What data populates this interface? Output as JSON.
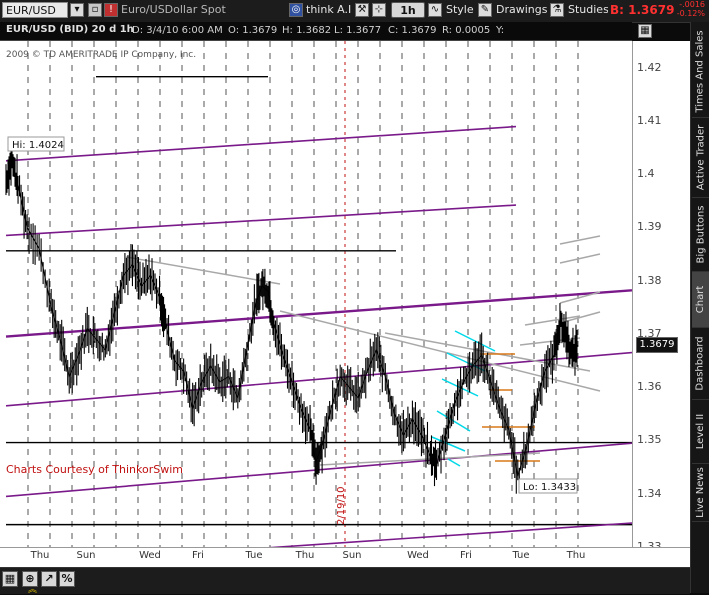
{
  "toolbar": {
    "symbol": "EUR/USD",
    "description": "Euro/USDollar Spot",
    "think_ai_label": "think A.I.",
    "interval": "1h",
    "style_label": "Style",
    "drawings_label": "Drawings",
    "studies_label": "Studies",
    "bid_label": "B:",
    "bid_value": "1.3679",
    "change_value": "-.0016",
    "change_pct": "-0.12%"
  },
  "header": {
    "title": "EUR/USD (BID) 20 d 1h",
    "date": "D: 3/4/10 6:00 AM",
    "open": "O: 1.3679",
    "high": "H: 1.3682",
    "low": "L: 1.3677",
    "close": "C: 1.3679",
    "range": "R: 0.0005",
    "y": "Y:"
  },
  "copyright": "2009 © TD AMERITRADE IP Company, Inc.",
  "watermark": "Charts Courtesy of ThinkorSwim",
  "hi_label": "Hi: 1.4024",
  "lo_label": "Lo: 1.3433",
  "date_marker": "2/19/10",
  "current_price": "1.3679",
  "colors": {
    "channel": "#7a1a8a",
    "support": "#000000",
    "fib": "#00d8e8",
    "orange": "#d8781a",
    "gray": "#a8a8a8",
    "bid": "#ff3030"
  },
  "sidebar": {
    "tabs": [
      "Times And Sales",
      "Active Trader",
      "Big Buttons",
      "Chart",
      "Dashboard",
      "Level II",
      "Live News"
    ]
  },
  "chart_data": {
    "type": "candlestick",
    "title": "EUR/USD (BID) 20 d 1h",
    "ylim": [
      1.33,
      1.425
    ],
    "yticks": [
      1.42,
      1.41,
      1.4,
      1.39,
      1.38,
      1.37,
      1.36,
      1.35,
      1.34,
      1.33
    ],
    "ytick_labels": [
      "1.42",
      "1.41",
      "1.4",
      "1.39",
      "1.38",
      "1.37",
      "1.36",
      "1.35",
      "1.34",
      "1.33"
    ],
    "xtick_labels": [
      "Thu",
      "Sun",
      "Wed",
      "Fri",
      "Tue",
      "Thu",
      "Sun",
      "Wed",
      "Fri",
      "Tue",
      "Thu"
    ],
    "grid": true,
    "price_path": [
      [
        0,
        1.399
      ],
      [
        0.4,
        1.4024
      ],
      [
        0.8,
        1.398
      ],
      [
        1.4,
        1.39
      ],
      [
        2.2,
        1.386
      ],
      [
        3,
        1.375
      ],
      [
        3.6,
        1.369
      ],
      [
        4.2,
        1.362
      ],
      [
        4.8,
        1.366
      ],
      [
        5.4,
        1.371
      ],
      [
        6,
        1.369
      ],
      [
        6.6,
        1.367
      ],
      [
        7.2,
        1.374
      ],
      [
        7.8,
        1.381
      ],
      [
        8.4,
        1.383
      ],
      [
        9,
        1.379
      ],
      [
        9.6,
        1.381
      ],
      [
        10.2,
        1.377
      ],
      [
        10.6,
        1.372
      ],
      [
        11.2,
        1.365
      ],
      [
        11.8,
        1.363
      ],
      [
        12.4,
        1.356
      ],
      [
        13,
        1.361
      ],
      [
        13.6,
        1.364
      ],
      [
        14.2,
        1.361
      ],
      [
        14.8,
        1.362
      ],
      [
        15.4,
        1.358
      ],
      [
        16,
        1.367
      ],
      [
        16.6,
        1.376
      ],
      [
        17,
        1.379
      ],
      [
        17.4,
        1.378
      ],
      [
        17.8,
        1.372
      ],
      [
        18.4,
        1.366
      ],
      [
        19,
        1.361
      ],
      [
        19.6,
        1.356
      ],
      [
        20.2,
        1.352
      ],
      [
        20.6,
        1.346
      ],
      [
        21,
        1.349
      ],
      [
        21.6,
        1.356
      ],
      [
        22.2,
        1.362
      ],
      [
        22.8,
        1.36
      ],
      [
        23.4,
        1.358
      ],
      [
        24,
        1.363
      ],
      [
        24.6,
        1.367
      ],
      [
        25.2,
        1.362
      ],
      [
        25.8,
        1.355
      ],
      [
        26.4,
        1.351
      ],
      [
        27,
        1.354
      ],
      [
        27.6,
        1.351
      ],
      [
        28.2,
        1.347
      ],
      [
        28.6,
        1.3455
      ],
      [
        29.2,
        1.351
      ],
      [
        29.8,
        1.357
      ],
      [
        30.4,
        1.361
      ],
      [
        31,
        1.364
      ],
      [
        31.6,
        1.366
      ],
      [
        32.2,
        1.361
      ],
      [
        32.8,
        1.356
      ],
      [
        33.4,
        1.352
      ],
      [
        34,
        1.3433
      ],
      [
        34.6,
        1.349
      ],
      [
        35.2,
        1.357
      ],
      [
        35.8,
        1.363
      ],
      [
        36.4,
        1.366
      ],
      [
        36.8,
        1.372
      ],
      [
        37.2,
        1.37
      ],
      [
        37.6,
        1.366
      ],
      [
        38,
        1.3679
      ]
    ],
    "channel_lines": [
      {
        "name": "upper",
        "y_start": 1.4025,
        "y_end": 1.4104
      },
      {
        "name": "upper-mid",
        "y_start": 1.3885,
        "y_end": 1.3955
      },
      {
        "name": "middle",
        "y_start": 1.3695,
        "y_end": 1.3782
      },
      {
        "name": "lower-mid",
        "y_start": 1.3565,
        "y_end": 1.3665
      },
      {
        "name": "lower",
        "y_start": 1.3395,
        "y_end": 1.3495
      },
      {
        "name": "bottom",
        "y_start": 1.3265,
        "y_end": 1.3345
      }
    ],
    "horizontal_levels": [
      1.4183,
      1.3856,
      1.3496,
      1.3342
    ],
    "annotations": [
      "Hi: 1.4024",
      "Lo: 1.3433",
      "2/19/10"
    ]
  }
}
